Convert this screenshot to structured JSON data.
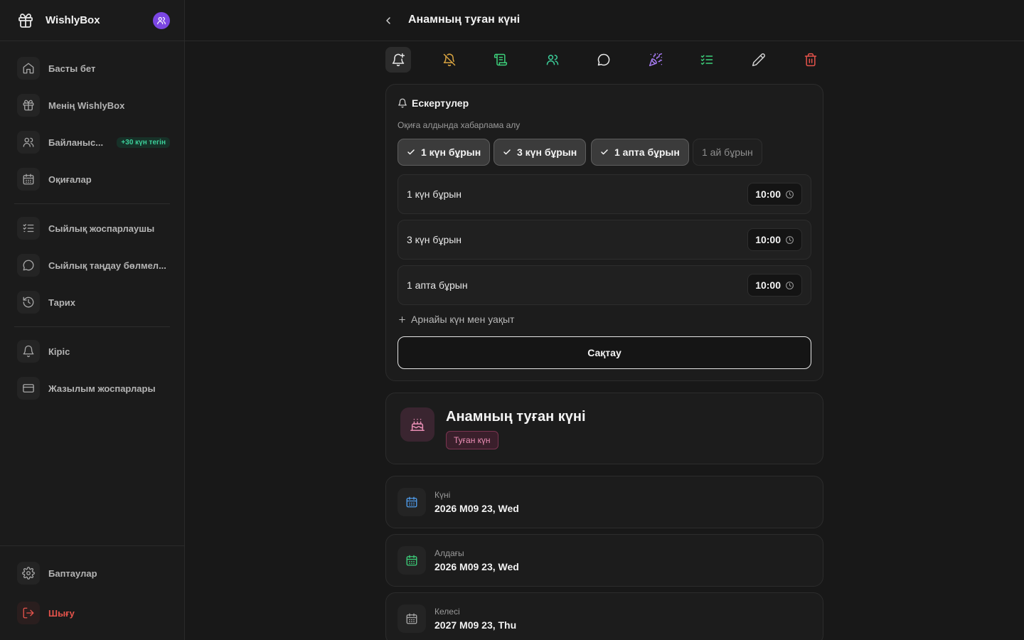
{
  "app": {
    "name": "WishlyBox"
  },
  "sidebar": {
    "items": [
      {
        "label": "Басты бет"
      },
      {
        "label": "Менің WishlyBox"
      },
      {
        "label": "Байланыс...",
        "badge": "+30 күн тегін"
      },
      {
        "label": "Оқиғалар"
      },
      {
        "label": "Сыйлық жоспарлаушы"
      },
      {
        "label": "Сыйлық таңдау бөлмел..."
      },
      {
        "label": "Тарих"
      },
      {
        "label": "Кіріс"
      },
      {
        "label": "Жазылым жоспарлары"
      }
    ],
    "settings_label": "Баптаулар",
    "logout_label": "Шығу"
  },
  "header": {
    "title": "Анамның туған күні"
  },
  "toolbar": {
    "icons": [
      "bell-plus-icon",
      "bell-off-icon",
      "scroll-icon",
      "users-icon",
      "chat-icon",
      "party-icon",
      "checklist-icon",
      "pencil-icon",
      "trash-icon"
    ]
  },
  "reminders": {
    "title": "Ескертулер",
    "subtitle": "Оқиға алдында хабарлама алу",
    "chips": [
      {
        "label": "1 күн бұрын",
        "selected": true
      },
      {
        "label": "3 күн бұрын",
        "selected": true
      },
      {
        "label": "1 апта бұрын",
        "selected": true
      },
      {
        "label": "1 ай бұрын",
        "selected": false
      }
    ],
    "rows": [
      {
        "label": "1 күн бұрын",
        "time": "10:00"
      },
      {
        "label": "3 күн бұрын",
        "time": "10:00"
      },
      {
        "label": "1 апта бұрын",
        "time": "10:00"
      }
    ],
    "custom_label": "Арнайы күн мен уақыт",
    "save_label": "Сақтау"
  },
  "event": {
    "title": "Анамның туған күні",
    "tag": "Туған күн"
  },
  "info": [
    {
      "label": "Күні",
      "value": "2026 M09 23, Wed",
      "color": "#4f9ded"
    },
    {
      "label": "Алдағы",
      "value": "2026 M09 23, Wed",
      "color": "#3ccf7a"
    },
    {
      "label": "Келесі",
      "value": "2027 M09 23, Thu",
      "color": "#a8a8a8"
    }
  ],
  "colors": {
    "accent_purple": "#7b46e3",
    "danger": "#e5534b",
    "success": "#3ccf9a",
    "tag_pink": "#ee8fb6"
  }
}
